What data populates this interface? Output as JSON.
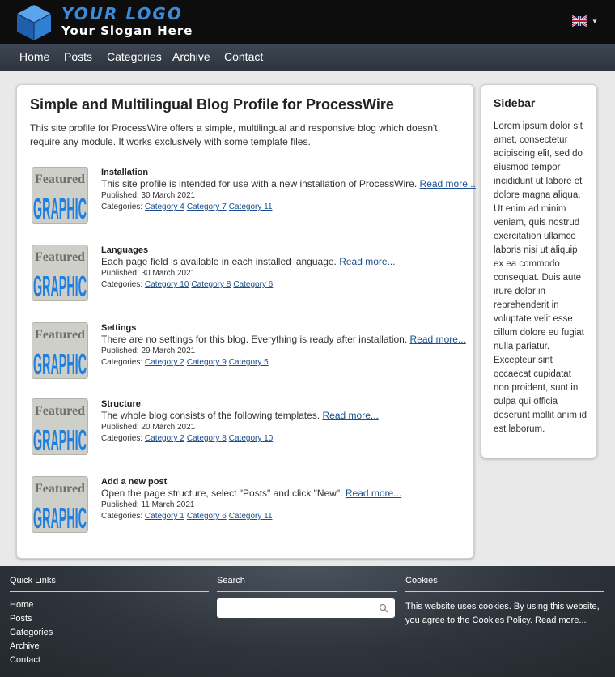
{
  "header": {
    "logo_title": "YOUR LOGO",
    "logo_slogan": "Your Slogan Here",
    "language_icon": "uk-flag-icon"
  },
  "nav": {
    "items": [
      "Home",
      "Posts",
      "Categories",
      "Archive",
      "Contact"
    ]
  },
  "main": {
    "title": "Simple and Multilingual Blog Profile for ProcessWire",
    "intro": "This site profile for ProcessWire offers a simple, multilingual and responsive blog which doesn't require any module. It works exclusively with some template files.",
    "thumb_text": [
      "Featured",
      "GRAPHIC"
    ],
    "published_label": "Published:",
    "categories_label": "Categories:",
    "read_more": "Read more...",
    "posts": [
      {
        "title": "Installation",
        "excerpt": "This site profile is intended for use with a new installation of ProcessWire.",
        "date": "30 March 2021",
        "categories": [
          "Category 4",
          "Category 7",
          "Category 11"
        ]
      },
      {
        "title": "Languages",
        "excerpt": "Each page field is available in each installed language.",
        "date": "30 March 2021",
        "categories": [
          "Category 10",
          "Category 8",
          "Category 6"
        ]
      },
      {
        "title": "Settings",
        "excerpt": "There are no settings for this blog. Everything is ready after installation.",
        "date": "29 March 2021",
        "categories": [
          "Category 2",
          "Category 9",
          "Category 5"
        ]
      },
      {
        "title": "Structure",
        "excerpt": "The whole blog consists of the following templates.",
        "date": "20 March 2021",
        "categories": [
          "Category 2",
          "Category 8",
          "Category 10"
        ]
      },
      {
        "title": "Add a new post",
        "excerpt": "Open the page structure, select \"Posts\" and click \"New\".",
        "date": "11 March 2021",
        "categories": [
          "Category 1",
          "Category 6",
          "Category 11"
        ]
      }
    ]
  },
  "sidebar": {
    "title": "Sidebar",
    "text": "Lorem ipsum dolor sit amet, consectetur adipiscing elit, sed do eiusmod tempor incididunt ut labore et dolore magna aliqua. Ut enim ad minim veniam, quis nostrud exercitation ullamco laboris nisi ut aliquip ex ea commodo consequat. Duis aute irure dolor in reprehenderit in voluptate velit esse cillum dolore eu fugiat nulla pariatur. Excepteur sint occaecat cupidatat non proident, sunt in culpa qui officia deserunt mollit anim id est laborum."
  },
  "footer": {
    "quick_links": {
      "title": "Quick Links",
      "items": [
        "Home",
        "Posts",
        "Categories",
        "Archive",
        "Contact"
      ]
    },
    "search": {
      "title": "Search",
      "value": "",
      "placeholder": ""
    },
    "cookies": {
      "title": "Cookies",
      "text": "This website uses cookies. By using this website, you agree to the Cookies Policy.",
      "link": "Read more..."
    }
  },
  "colors": {
    "header_bg": "#0d0d0d",
    "logo_blue": "#3d8bd8",
    "nav_bg": "#333a44",
    "link": "#1a4f8f",
    "thumb_blue": "#1e7fe0",
    "footer_bg": "#2e343b"
  }
}
